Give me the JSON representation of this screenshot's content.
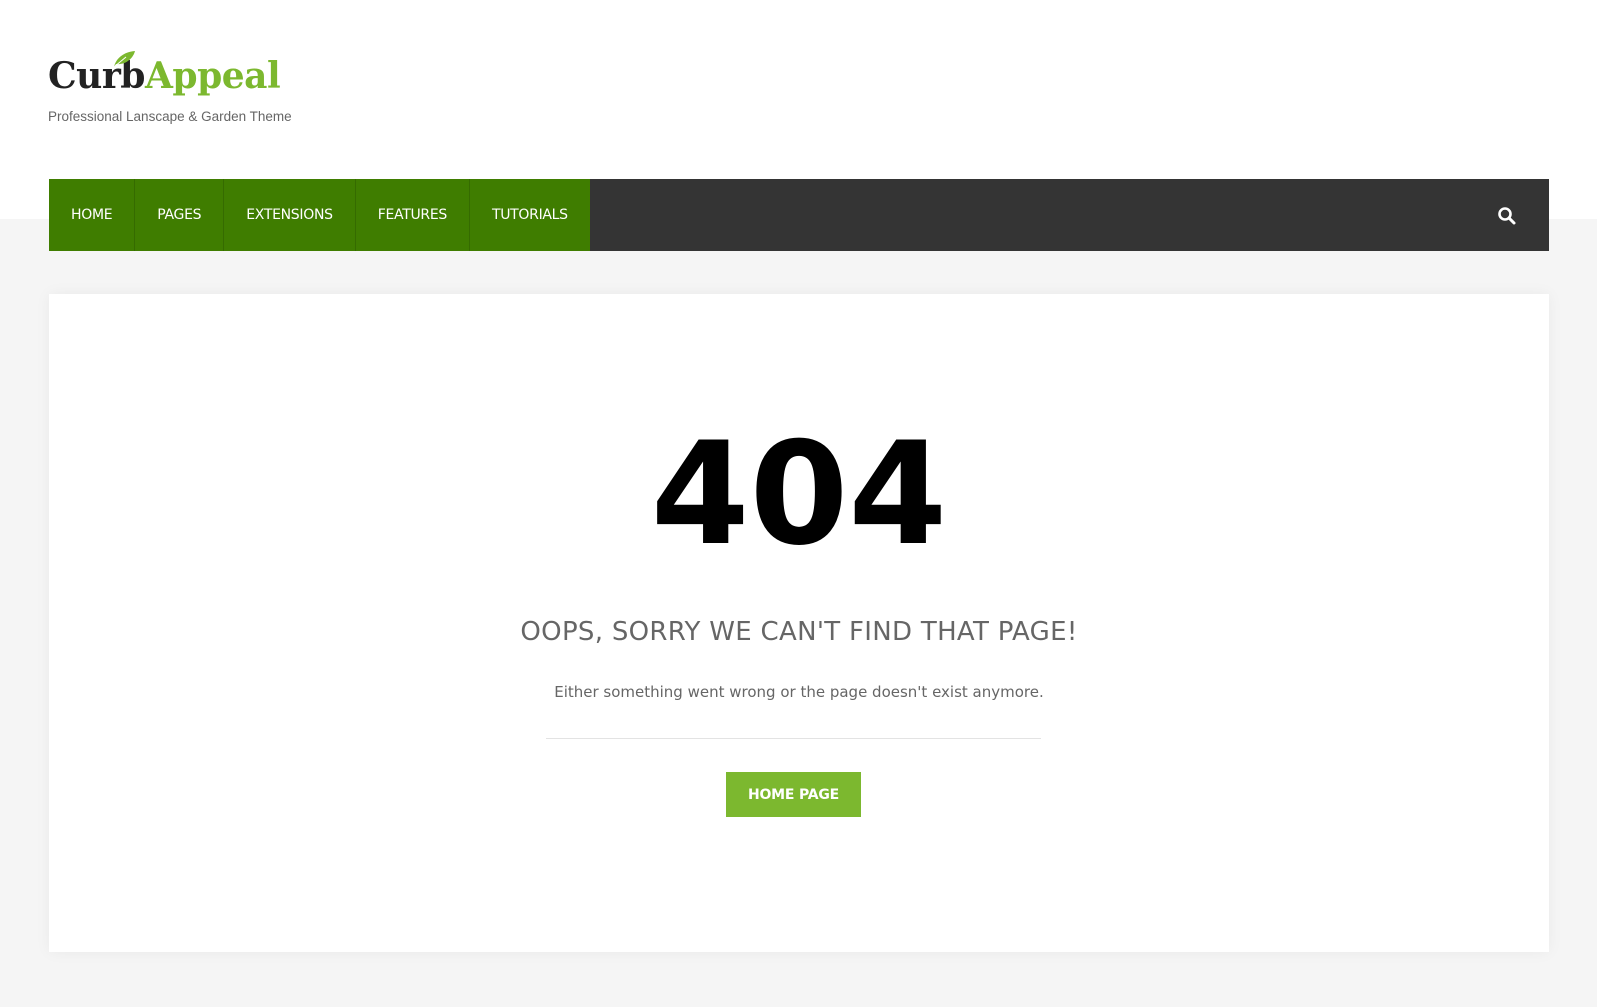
{
  "brand": {
    "name_part1": "Curb",
    "name_part2": "Appeal",
    "tagline": "Professional Lanscape & Garden Theme",
    "color_dark": "#222222",
    "color_green": "#7cb82f"
  },
  "nav": {
    "items": [
      {
        "label": "HOME"
      },
      {
        "label": "PAGES"
      },
      {
        "label": "EXTENSIONS"
      },
      {
        "label": "FEATURES"
      },
      {
        "label": "TUTORIALS"
      }
    ],
    "menu_bg": "#3f7d00",
    "bar_bg": "#343434",
    "search_icon": "search-icon"
  },
  "error": {
    "code": "404",
    "heading": "OOPS, SORRY WE CAN'T FIND THAT PAGE!",
    "message": "Either something went wrong or the page doesn't exist anymore.",
    "button_label": "HOME PAGE",
    "button_color": "#7cb82f"
  }
}
